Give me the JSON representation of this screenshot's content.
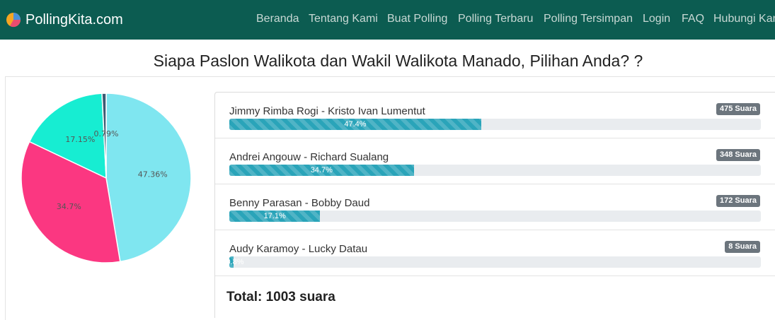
{
  "navbar": {
    "brand": "PollingKita.com",
    "items": [
      "Beranda",
      "Tentang Kami",
      "Buat Polling",
      "Polling Terbaru",
      "Polling Tersimpan",
      "Login",
      "FAQ",
      "Hubungi Kami"
    ]
  },
  "poll": {
    "title": "Siapa Paslon Walikota dan Wakil Walikota Manado, Pilihan Anda? ?",
    "options": [
      {
        "name": "Jimmy Rimba Rogi - Kristo Ivan Lumentut",
        "votes": "475 Suara",
        "percent_label": "47.4%",
        "percent": 47.4
      },
      {
        "name": "Andrei Angouw - Richard Sualang",
        "votes": "348 Suara",
        "percent_label": "34.7%",
        "percent": 34.7
      },
      {
        "name": "Benny Parasan - Bobby Daud",
        "votes": "172 Suara",
        "percent_label": "17.1%",
        "percent": 17.1
      },
      {
        "name": "Audy Karamoy - Lucky Datau",
        "votes": "8 Suara",
        "percent_label": "0.8%",
        "percent": 0.8
      }
    ],
    "total": "Total: 1003 suara"
  },
  "chart_data": {
    "type": "pie",
    "categories": [
      "Jimmy Rimba Rogi - Kristo Ivan Lumentut",
      "Andrei Angouw - Richard Sualang",
      "Benny Parasan - Bobby Daud",
      "Audy Karamoy - Lucky Datau"
    ],
    "values": [
      47.36,
      34.7,
      17.15,
      0.79
    ],
    "labels": [
      "47.36%",
      "34.7%",
      "17.15%",
      "0.79%"
    ],
    "colors": [
      "#7fe6f0",
      "#fb3781",
      "#17edd2",
      "#3c5a73"
    ]
  }
}
